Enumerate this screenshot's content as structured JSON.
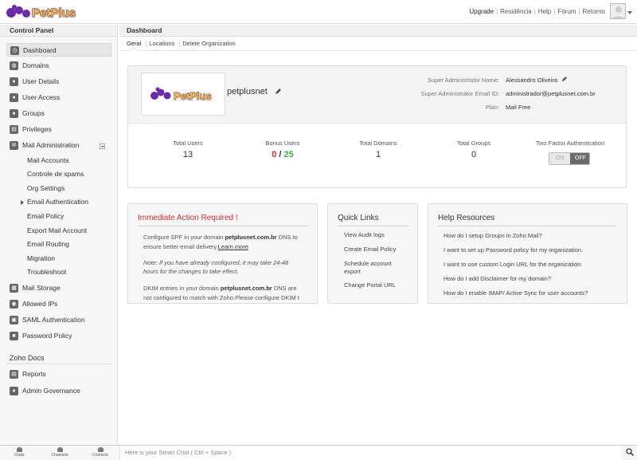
{
  "brand": {
    "logo_text": "PetPlus",
    "accent": "#6d2aa6",
    "logo_yellow": "#f4c21a"
  },
  "header": {
    "links": [
      "Upgrade",
      "Residência",
      "Help",
      "Fórum",
      "Retorno"
    ]
  },
  "sidebar": {
    "title": "Control Panel",
    "items": [
      {
        "label": "Dashboard",
        "icon": "dashboard-icon"
      },
      {
        "label": "Domains",
        "icon": "globe-icon"
      },
      {
        "label": "User Details",
        "icon": "user-icon"
      },
      {
        "label": "User Access",
        "icon": "user-access-icon"
      },
      {
        "label": "Groups",
        "icon": "groups-icon"
      },
      {
        "label": "Privileges",
        "icon": "privileges-icon"
      },
      {
        "label": "Mail Administration",
        "icon": "mail-icon"
      }
    ],
    "mail_sub": [
      "Mail Accounts",
      "Controle de spams",
      "Org Settings",
      "Email Authentication",
      "Email Policy",
      "Export Mail Account",
      "Email Routing",
      "Migration",
      "Troubleshoot"
    ],
    "items2": [
      {
        "label": "Mail Storage",
        "icon": "storage-icon"
      },
      {
        "label": "Allowed IPs",
        "icon": "ip-icon"
      },
      {
        "label": "SAML Authentication",
        "icon": "saml-icon"
      },
      {
        "label": "Password Policy",
        "icon": "lock-icon"
      }
    ],
    "section2": "Zoho Docs",
    "items3": [
      {
        "label": "Reports",
        "icon": "reports-icon"
      },
      {
        "label": "Admin Governance",
        "icon": "governance-icon"
      }
    ]
  },
  "bottom": {
    "chats": "Chats",
    "channels": "Channels",
    "contacts": "Contacts",
    "chat_placeholder": "Here is your Smart Chat ( Ctrl + Space )"
  },
  "main": {
    "title": "Dashboard",
    "tabs": [
      "Geral",
      "Locations",
      "Delete Organization"
    ],
    "org": {
      "name": "petplusnet",
      "admin_name_label": "Super Administrator Name:",
      "admin_name": "Alessandro Oliveira",
      "admin_email_label": "Super Administrator Email ID:",
      "admin_email": "administrador@petplusnet.com.br",
      "plan_label": "Plan:",
      "plan": "Mail Free"
    },
    "stats": {
      "total_users_label": "Total Users",
      "total_users": "13",
      "bonus_label": "Bonus Users",
      "bonus_used": "0",
      "bonus_sep": " / ",
      "bonus_total": "25",
      "domains_label": "Total Domains",
      "domains": "1",
      "groups_label": "Total Groups",
      "groups": "0",
      "tfa_label": "Two Factor Authentication",
      "tfa_on": "ON",
      "tfa_off": "OFF"
    },
    "action": {
      "title": "Immediate Action Required !",
      "p1_pre": "Configure SPF in your domain ",
      "p1_domain": "petplusnet.com.br",
      "p1_post": " DNS to ensure better email delivery.",
      "p1_link": "Learn more",
      "note": "Note: If you have already configured, it may take 24-48 hours for the changes to take effect.",
      "p2_pre": "DKIM entries in your domain ",
      "p2_domain": "petplusnet.com.br",
      "p2_post": " DNS are not configured to match with Zoho.Please configure DKIM t"
    },
    "quick_links": {
      "title": "Quick Links",
      "items": [
        "View Audit logs",
        "Create Email Policy",
        "Schedule account export",
        "Change Portal URL"
      ]
    },
    "help": {
      "title": "Help Resources",
      "items": [
        "How do I setup Groups in Zoho Mail?",
        "I want to set up Password policy for my organization.",
        "I want to use custom Login URL for the organization.",
        "How do I add Disclaimer for my domain?",
        "How do I enable IMAP/ Active Sync for user accounts?"
      ]
    }
  }
}
